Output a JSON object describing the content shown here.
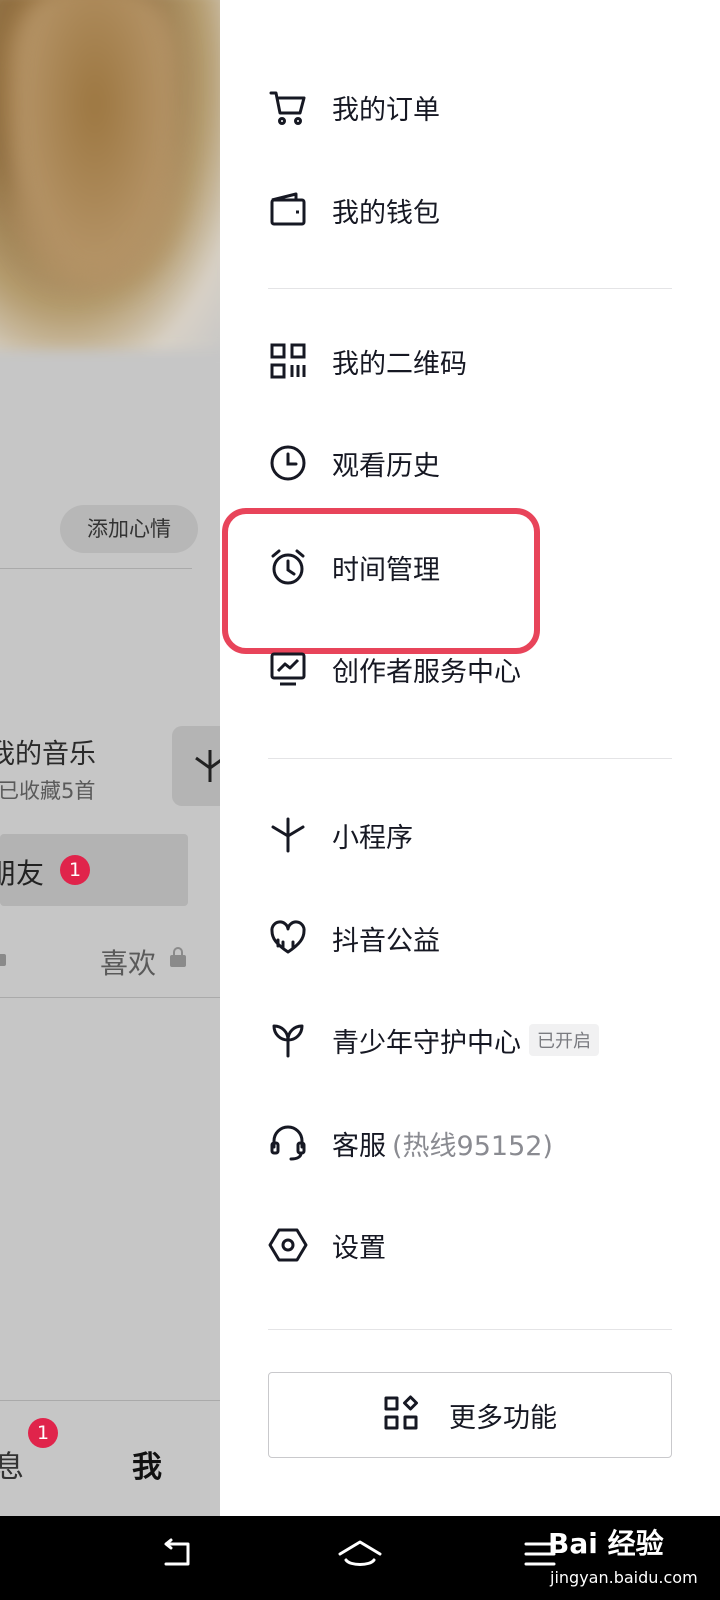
{
  "profile": {
    "mood_button": "添加心情",
    "music_title": "我的音乐",
    "music_subtitle": "已收藏5首",
    "friends_label": "朋友",
    "friends_badge": "1",
    "likes_tab": "喜欢",
    "messages_tab": "息",
    "messages_badge": "1",
    "me_tab": "我"
  },
  "drawer": {
    "items": [
      {
        "label": "我的订单",
        "icon": "cart-icon"
      },
      {
        "label": "我的钱包",
        "icon": "wallet-icon"
      },
      {
        "label": "我的二维码",
        "icon": "qrcode-icon"
      },
      {
        "label": "观看历史",
        "icon": "clock-icon"
      },
      {
        "label": "时间管理",
        "icon": "alarm-clock-icon"
      },
      {
        "label": "创作者服务中心",
        "icon": "monitor-chart-icon"
      },
      {
        "label": "小程序",
        "icon": "mini-program-icon"
      },
      {
        "label": "抖音公益",
        "icon": "heart-icon"
      },
      {
        "label": "青少年守护中心",
        "icon": "sprout-icon",
        "tag": "已开启"
      },
      {
        "label": "客服",
        "icon": "headset-icon",
        "sub": "(热线95152)"
      },
      {
        "label": "设置",
        "icon": "hexagon-settings-icon"
      }
    ],
    "more_button": "更多功能",
    "highlight_color": "#e8445a"
  },
  "navbar": {
    "watermark": "Bai 经验",
    "watermark_sub": "jingyan.baidu.com"
  }
}
